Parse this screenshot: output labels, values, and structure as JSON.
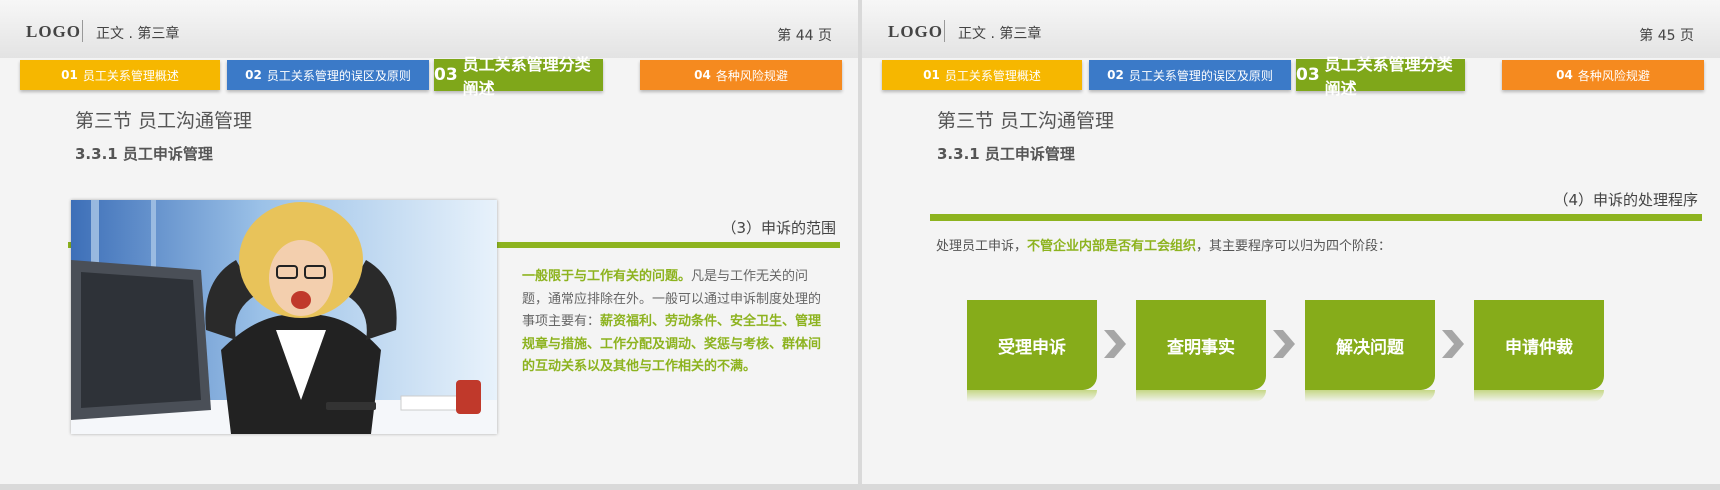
{
  "header": {
    "logo": "LOGO",
    "chapter": "正文 . 第三章"
  },
  "nav_tabs": [
    {
      "num": "01",
      "label": "员工关系管理概述",
      "color": "#f6b700"
    },
    {
      "num": "02",
      "label": "员工关系管理的误区及原则",
      "color": "#3b7ac8"
    },
    {
      "num": "03",
      "label": "员工关系管理分类阐述",
      "color": "#7fa71a"
    },
    {
      "num": "04",
      "label": "各种风险规避",
      "color": "#f58a1f"
    }
  ],
  "slide_left": {
    "page": "第 44 页",
    "section_title": "第三节  员工沟通管理",
    "subsection": "3.3.1 员工申诉管理",
    "heading": "（3）申诉的范围",
    "body": {
      "lead": "一般限于与工作有关的问题。",
      "middle": "凡是与工作无关的问题，通常应排除在外。一般可以通过申诉制度处理的事项主要有：",
      "highlight": "薪资福利、劳动条件、安全卫生、管理规章与措施、工作分配及调动、奖惩与考核、群体间的互动关系以及其他与工作相关的不满。"
    }
  },
  "slide_right": {
    "page": "第 45 页",
    "section_title": "第三节  员工沟通管理",
    "subsection": "3.3.1 员工申诉管理",
    "heading": "（4）申诉的处理程序",
    "intro": {
      "before": "处理员工申诉，",
      "highlight": "不管企业内部是否有工会组织",
      "after": "，其主要程序可以归为四个阶段："
    },
    "steps": [
      "受理申诉",
      "查明事实",
      "解决问题",
      "申请仲裁"
    ]
  },
  "colors": {
    "accent_green": "#8db31f",
    "arrow_gray": "#a6a6a6"
  },
  "icons": [
    "chevron-right-icon"
  ]
}
